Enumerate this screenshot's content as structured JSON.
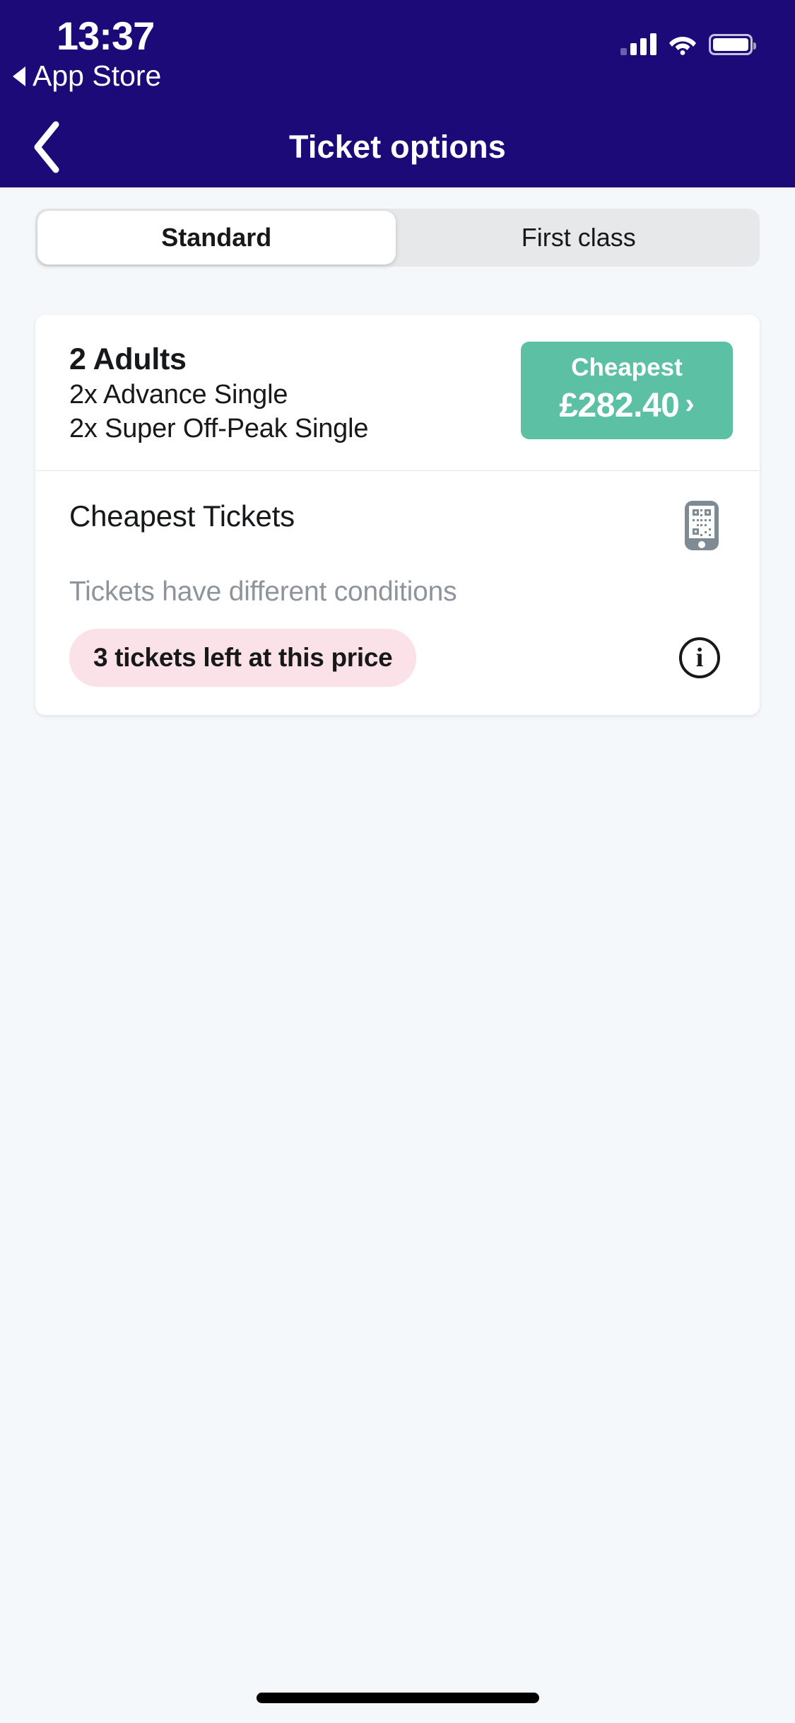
{
  "status_bar": {
    "time": "13:37",
    "back_app_label": "App Store",
    "signal_icon": "cellular-signal-icon",
    "wifi_icon": "wifi-icon",
    "battery_icon": "battery-icon"
  },
  "header": {
    "title": "Ticket options",
    "back_icon": "chevron-left-icon",
    "background_color": "#1b0a77"
  },
  "segmented_control": {
    "options": [
      {
        "label": "Standard",
        "selected": true
      },
      {
        "label": "First class",
        "selected": false
      }
    ]
  },
  "ticket_card": {
    "passengers": "2 Adults",
    "fare_lines": [
      "2x Advance Single",
      "2x Super Off-Peak Single"
    ],
    "price_button": {
      "label": "Cheapest",
      "amount": "£282.40",
      "chevron": "›",
      "color": "#5cc0a4"
    },
    "details": {
      "name": "Cheapest Tickets",
      "subtitle": "Tickets have different conditions",
      "delivery_icon": "mobile-ticket-qr-icon",
      "availability_badge": "3 tickets left at this price",
      "availability_badge_color": "#fbe2e8",
      "info_icon": "info-circle-icon",
      "info_icon_letter": "i"
    }
  }
}
